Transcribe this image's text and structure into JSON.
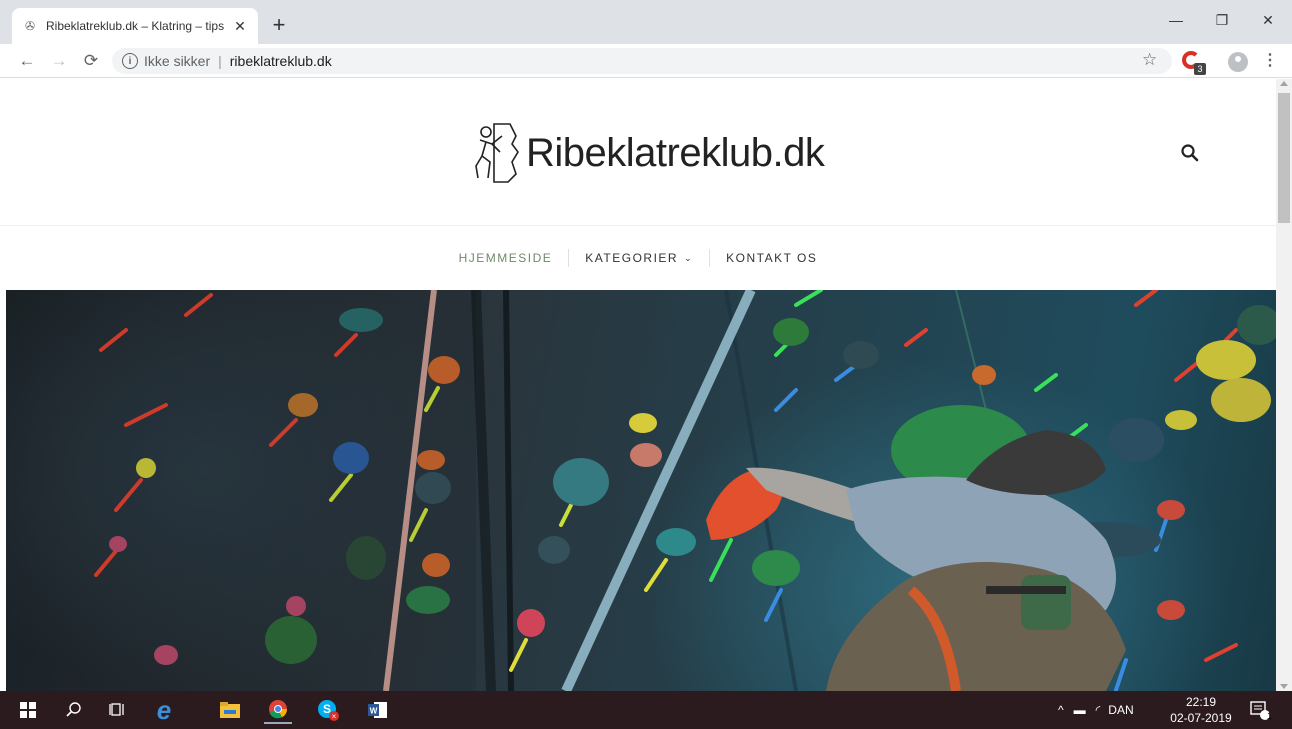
{
  "browser": {
    "tab_title": "Ribeklatreklub.dk – Klatring – tips",
    "security_label": "Ikke sikker",
    "url": "ribeklatreklub.dk",
    "extension_badge": "3"
  },
  "site": {
    "logo_text": "Ribeklatreklub.dk",
    "nav": [
      {
        "label": "HJEMMESIDE"
      },
      {
        "label": "KATEGORIER"
      },
      {
        "label": "KONTAKT OS"
      }
    ]
  },
  "taskbar": {
    "language": "DAN",
    "time": "22:19",
    "date": "02-07-2019",
    "notification_count": "1"
  },
  "colors": {
    "nav_active": "#6f8a6a",
    "taskbar_bg": "#2b1a1e"
  }
}
